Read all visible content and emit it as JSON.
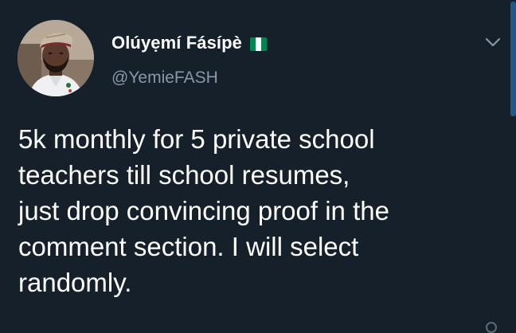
{
  "tweet": {
    "author": {
      "display_name": "Olúyẹmí Fásípè",
      "handle": "@YemieFASH",
      "verified_flag": "nigeria-flag-icon",
      "avatar": "avatar-photo"
    },
    "text": "5k monthly for 5 private school\nteachers till school resumes,\njust drop convincing proof in the\ncomment section. I will select\nrandomly.",
    "menu_icon": "chevron-down-icon"
  },
  "colors": {
    "background": "#15202b",
    "text_primary": "#ffffff",
    "text_secondary": "#8899a6",
    "flag_green": "#008751",
    "scrollbar": "#1d5a8a"
  }
}
